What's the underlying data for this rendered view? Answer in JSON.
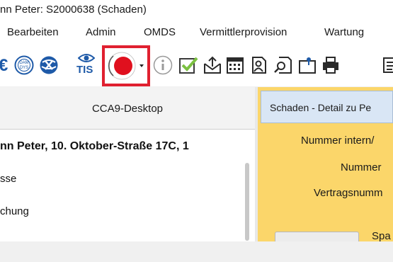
{
  "window": {
    "title": "nn Peter: S2000638 (Schaden)"
  },
  "menu": {
    "items": [
      "Bearbeiten",
      "Admin",
      "OMDS",
      "Vermittlerprovision",
      "Wartung"
    ]
  },
  "toolbar": {
    "icons": [
      "euro-icon",
      "damage-stamp-icon",
      "globe-badge-icon",
      "tis-icon",
      "record-button-icon",
      "info-icon",
      "checkbox-icon",
      "mail-upload-icon",
      "calendar-icon",
      "person-document-icon",
      "search-document-icon",
      "folder-pin-icon",
      "printer-icon"
    ],
    "tis_label": "TIS",
    "highlight_color": "#e02030"
  },
  "left_panel": {
    "title": "CCA9-Desktop",
    "tree": {
      "root": "nn Peter, 10. Oktober-Straße 17C, 1",
      "items": [
        "sse",
        "chung"
      ]
    }
  },
  "right_panel": {
    "header": "Schaden - Detail zu Pe",
    "labels": [
      "Nummer intern/",
      "Nummer",
      "Vertragsnumm",
      "Spa"
    ],
    "bg_color": "#fbd66a"
  }
}
